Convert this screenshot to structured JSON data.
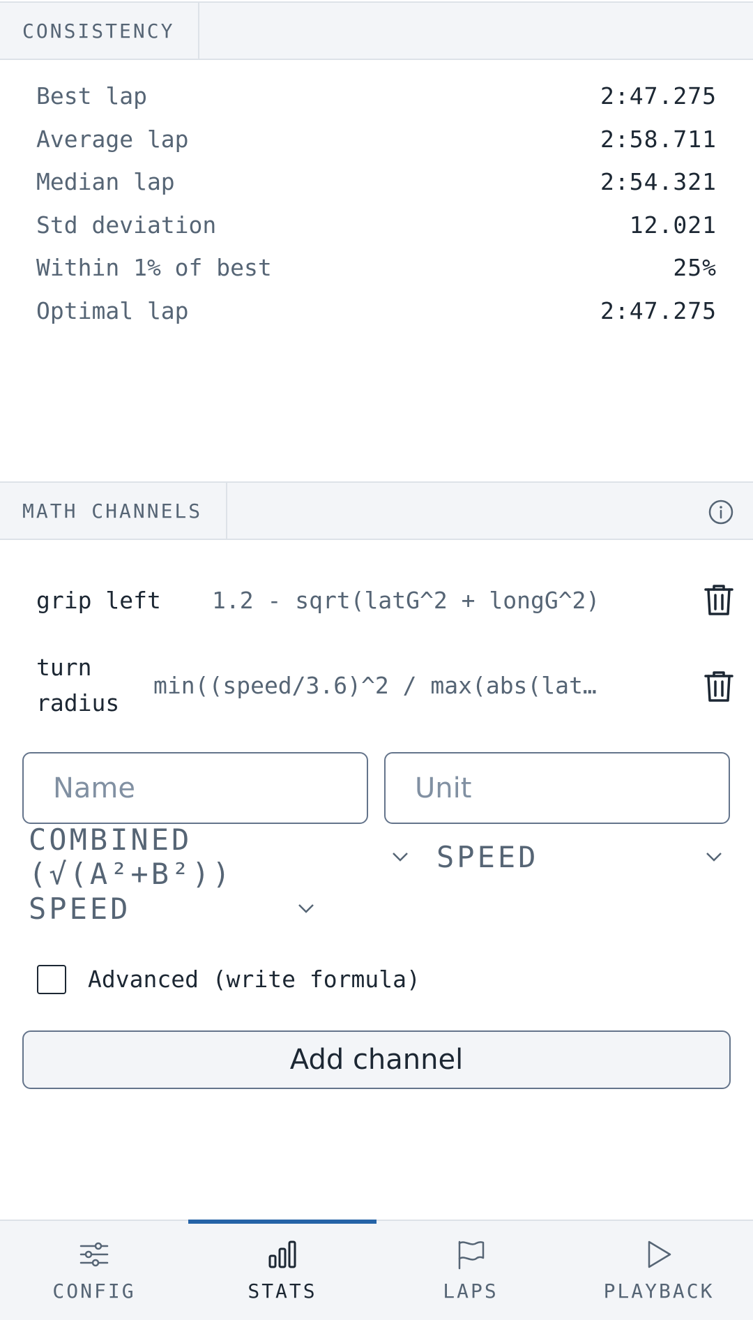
{
  "consistency": {
    "title": "CONSISTENCY",
    "rows": [
      {
        "label": "Best lap",
        "value": "2:47.275"
      },
      {
        "label": "Average lap",
        "value": "2:58.711"
      },
      {
        "label": "Median lap",
        "value": "2:54.321"
      },
      {
        "label": "Std deviation",
        "value": "12.021"
      },
      {
        "label": "Within 1% of best",
        "value": "25%"
      },
      {
        "label": "Optimal lap",
        "value": "2:47.275"
      }
    ]
  },
  "math_channels": {
    "title": "MATH CHANNELS",
    "channels": [
      {
        "name": "grip left",
        "formula": "1.2 - sqrt(latG^2 + longG^2)"
      },
      {
        "name": "turn radius",
        "formula": "min((speed/3.6)^2 / max(abs(lat…"
      }
    ],
    "name_placeholder": "Name",
    "unit_placeholder": "Unit",
    "operation_select": "COMBINED (√(A²+B²))",
    "channel_a_select": "SPEED",
    "channel_b_select": "SPEED",
    "advanced_label": "Advanced (write formula)",
    "add_button": "Add channel"
  },
  "nav": {
    "items": [
      {
        "label": "CONFIG",
        "icon": "sliders-icon"
      },
      {
        "label": "STATS",
        "icon": "bar-chart-icon"
      },
      {
        "label": "LAPS",
        "icon": "flag-icon"
      },
      {
        "label": "PLAYBACK",
        "icon": "play-icon"
      }
    ],
    "active": "STATS"
  },
  "colors": {
    "accent": "#2563a7",
    "text": "#1c2733",
    "muted": "#566575",
    "panel": "#f3f5f8"
  }
}
